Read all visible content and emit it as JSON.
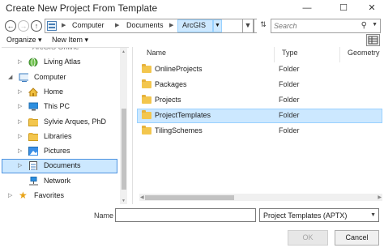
{
  "window": {
    "title": "Create New Project From Template",
    "minimize_glyph": "—",
    "maximize_glyph": "☐",
    "close_glyph": "✕"
  },
  "address_bar": {
    "breadcrumbs": [
      "Computer",
      "Documents",
      "ArcGIS"
    ],
    "search_placeholder": "Search"
  },
  "toolbar": {
    "organize_label": "Organize ▾",
    "new_item_label": "New Item ▾"
  },
  "nav_tree": {
    "items": [
      {
        "label": "Living Atlas",
        "icon": "globe-icon"
      },
      {
        "label": "Computer",
        "icon": "computer-icon"
      },
      {
        "label": "Home",
        "icon": "home-icon"
      },
      {
        "label": "This PC",
        "icon": "monitor-icon"
      },
      {
        "label": "Sylvie Arques, PhD",
        "icon": "user-folder-icon"
      },
      {
        "label": "Libraries",
        "icon": "folder-icon"
      },
      {
        "label": "Pictures",
        "icon": "pictures-icon"
      },
      {
        "label": "Documents",
        "icon": "documents-icon",
        "selected": true
      },
      {
        "label": "Network",
        "icon": "network-icon"
      },
      {
        "label": "Favorites",
        "icon": "star-icon"
      }
    ]
  },
  "file_list": {
    "columns": [
      "Name",
      "Type",
      "Geometry"
    ],
    "rows": [
      {
        "name": "OnlineProjects",
        "type": "Folder"
      },
      {
        "name": "Packages",
        "type": "Folder"
      },
      {
        "name": "Projects",
        "type": "Folder"
      },
      {
        "name": "ProjectTemplates",
        "type": "Folder",
        "selected": true
      },
      {
        "name": "TilingSchemes",
        "type": "Folder"
      }
    ]
  },
  "bottom": {
    "name_label": "Name",
    "name_value": "",
    "filter_value": "Project Templates (APTX)",
    "ok_label": "OK",
    "cancel_label": "Cancel"
  },
  "colors": {
    "selection": "#cce8ff",
    "folder": "#f3c64d",
    "accent_border": "#4d93e0"
  }
}
